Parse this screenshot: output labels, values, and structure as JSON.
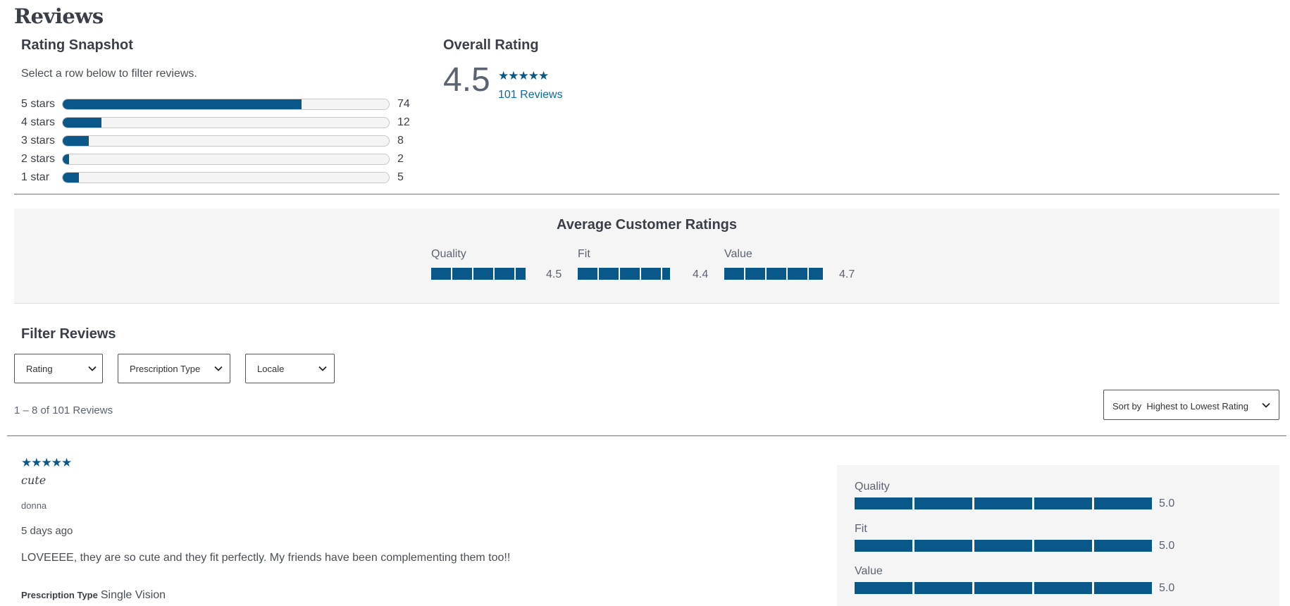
{
  "page": {
    "title": "Reviews"
  },
  "snapshot": {
    "title": "Rating Snapshot",
    "hint": "Select a row below to filter reviews.",
    "rows": [
      {
        "label": "5 stars",
        "count": "74",
        "fraction": 0.733
      },
      {
        "label": "4 stars",
        "count": "12",
        "fraction": 0.119
      },
      {
        "label": "3 stars",
        "count": "8",
        "fraction": 0.079
      },
      {
        "label": "2 stars",
        "count": "2",
        "fraction": 0.02
      },
      {
        "label": "1 star",
        "count": "5",
        "fraction": 0.05
      }
    ]
  },
  "overall": {
    "title": "Overall Rating",
    "value": "4.5",
    "stars": "★★★★★",
    "star_rating": 4.5,
    "count_label": "101 Reviews"
  },
  "average": {
    "title": "Average Customer Ratings",
    "items": [
      {
        "label": "Quality",
        "value": "4.5",
        "score": 4.5
      },
      {
        "label": "Fit",
        "value": "4.4",
        "score": 4.4
      },
      {
        "label": "Value",
        "value": "4.7",
        "score": 4.7
      }
    ]
  },
  "filters": {
    "title": "Filter Reviews",
    "dropdowns": [
      "Rating",
      "Prescription Type",
      "Locale"
    ]
  },
  "results": {
    "count_text": "1 – 8 of 101 Reviews",
    "sort_prefix": "Sort by",
    "sort_value": "Highest to Lowest Rating"
  },
  "review": {
    "stars": "★★★★★",
    "star_rating": 5,
    "title": "cute",
    "author": "donna",
    "date": "5 days ago",
    "body": "LOVEEEE, they are so cute and they fit perfectly. My friends have been complementing them too!!",
    "rx_label": "Prescription Type",
    "rx_value": "Single Vision",
    "ratings": [
      {
        "label": "Quality",
        "value": "5.0"
      },
      {
        "label": "Fit",
        "value": "5.0"
      },
      {
        "label": "Value",
        "value": "5.0"
      }
    ]
  },
  "colors": {
    "accent": "#0a578a",
    "link": "#0a6aa6",
    "panel": "#f5f5f5"
  }
}
